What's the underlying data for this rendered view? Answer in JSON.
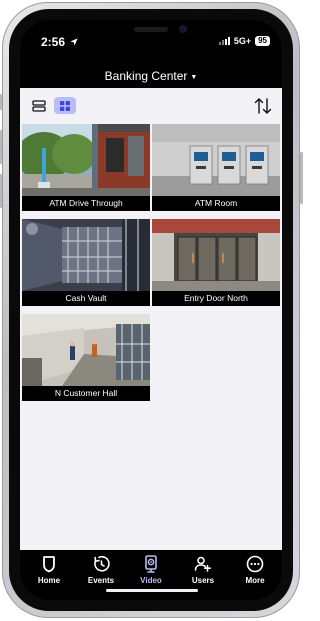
{
  "status_bar": {
    "time": "2:56",
    "network": "5G+",
    "battery": "95"
  },
  "header": {
    "title": "Banking Center"
  },
  "cameras": [
    {
      "name": "ATM Drive Through"
    },
    {
      "name": "ATM Room"
    },
    {
      "name": "Cash Vault"
    },
    {
      "name": "Entry Door North"
    },
    {
      "name": "N Customer Hall"
    }
  ],
  "tabbar": {
    "items": [
      {
        "label": "Home",
        "icon": "shield-icon"
      },
      {
        "label": "Events",
        "icon": "history-clock-icon"
      },
      {
        "label": "Video",
        "icon": "video-camera-icon",
        "active": true
      },
      {
        "label": "Users",
        "icon": "users-icon"
      },
      {
        "label": "More",
        "icon": "more-dots-icon"
      }
    ],
    "active_color": "#b9bdf6"
  },
  "colors": {
    "content_bg": "#f2f2f7",
    "grid_toggle_active": "#b9bdf6",
    "grid_icon": "#3d45e0"
  }
}
